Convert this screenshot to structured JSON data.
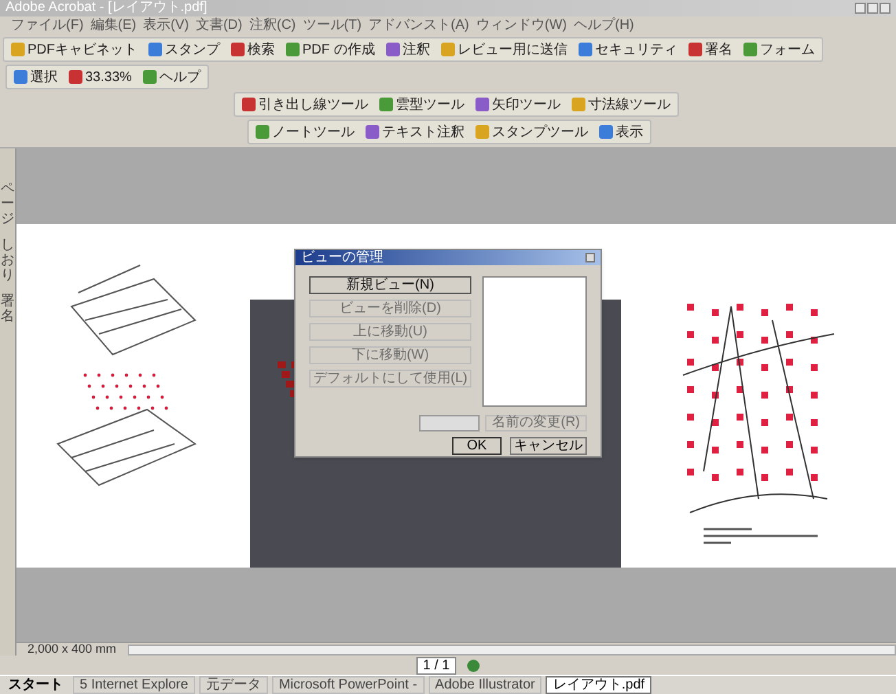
{
  "window": {
    "title": "Adobe Acrobat - [レイアウト.pdf]"
  },
  "menu": [
    "ファイル(F)",
    "編集(E)",
    "表示(V)",
    "文書(D)",
    "注釈(C)",
    "ツール(T)",
    "アドバンスト(A)",
    "ウィンドウ(W)",
    "ヘルプ(H)"
  ],
  "toolbars": [
    [
      {
        "label": "PDFキャビネット"
      },
      {
        "label": "スタンプ"
      },
      {
        "label": "検索"
      },
      {
        "label": "PDF の作成"
      },
      {
        "label": "注釈"
      },
      {
        "label": "レビュー用に送信"
      },
      {
        "label": "セキュリティ"
      },
      {
        "label": "署名"
      },
      {
        "label": "フォーム"
      }
    ],
    [
      {
        "label": "選択"
      },
      {
        "label": "33.33%"
      },
      {
        "label": "ヘルプ"
      }
    ],
    [
      {
        "label": "引き出し線ツール"
      },
      {
        "label": "雲型ツール"
      },
      {
        "label": "矢印ツール"
      },
      {
        "label": "寸法線ツール"
      }
    ],
    [
      {
        "label": "ノートツール"
      },
      {
        "label": "テキスト注釈"
      },
      {
        "label": "スタンプツール"
      },
      {
        "label": "表示"
      }
    ]
  ],
  "sidebar_tabs": [
    "ページ",
    "しおり",
    "署名"
  ],
  "dialog": {
    "title": "ビューの管理",
    "buttons": [
      {
        "label": "新規ビュー(N)",
        "disabled": false
      },
      {
        "label": "ビューを削除(D)",
        "disabled": true
      },
      {
        "label": "上に移動(U)",
        "disabled": true
      },
      {
        "label": "下に移動(W)",
        "disabled": true
      },
      {
        "label": "デフォルトにして使用(L)",
        "disabled": true
      }
    ],
    "rename": {
      "label": "名前の変更(R)",
      "disabled": true
    },
    "ok": "OK",
    "cancel": "キャンセル"
  },
  "status": {
    "page_size": "2,000 x 400 mm",
    "page_indicator": "1 / 1"
  },
  "taskbar": {
    "start": "スタート",
    "items": [
      {
        "label": "5 Internet Explore",
        "selected": false
      },
      {
        "label": "元データ",
        "selected": false
      },
      {
        "label": "Microsoft PowerPoint -",
        "selected": false
      },
      {
        "label": "Adobe Illustrator",
        "selected": false
      },
      {
        "label": "レイアウト.pdf",
        "selected": true
      }
    ]
  }
}
